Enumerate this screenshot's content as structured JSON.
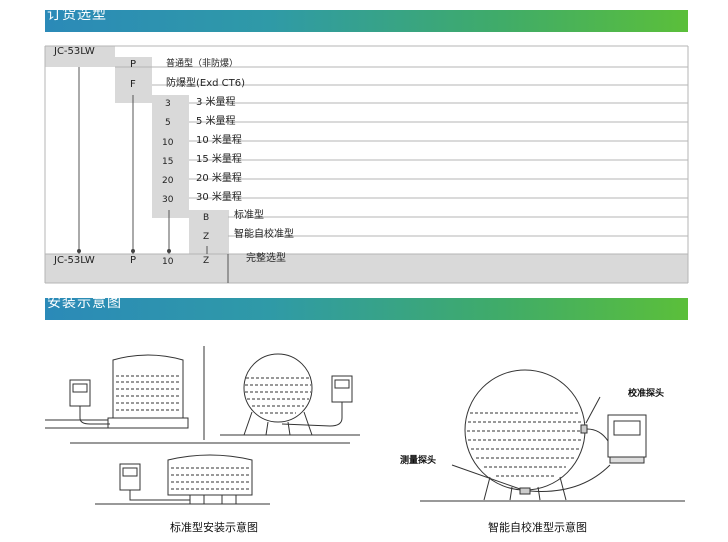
{
  "sections": {
    "order_title": "订货选型",
    "install_title": "安装示意图"
  },
  "order_table": {
    "model": "JC-53LW",
    "explosion_options": [
      {
        "code": "P",
        "desc": "普通型（非防爆）"
      },
      {
        "code": "F",
        "desc": "防爆型(Exd  CT6)"
      }
    ],
    "range_options": [
      {
        "code": "3",
        "desc": "3 米量程"
      },
      {
        "code": "5",
        "desc": "5 米量程"
      },
      {
        "code": "10",
        "desc": "10 米量程"
      },
      {
        "code": "15",
        "desc": "15 米量程"
      },
      {
        "code": "20",
        "desc": "20 米量程"
      },
      {
        "code": "30",
        "desc": "30 米量程"
      }
    ],
    "calib_options": [
      {
        "code": "B",
        "desc": "标准型"
      },
      {
        "code": "Z",
        "desc": "智能自校准型"
      }
    ],
    "example": {
      "model": "JC-53LW",
      "explosion": "P",
      "range": "10",
      "calib": "Z",
      "desc": "完整选型"
    }
  },
  "figures": {
    "standard_caption": "标准型安装示意图",
    "smart_caption": "智能自校准型示意图",
    "calib_probe_label": "校准探头",
    "measure_probe_label": "测量探头"
  },
  "colors": {
    "band_start": "#2b8ab8",
    "band_end": "#5bbf3a",
    "table_shade": "#d9d9d9",
    "row_line": "#b5b5b5"
  }
}
